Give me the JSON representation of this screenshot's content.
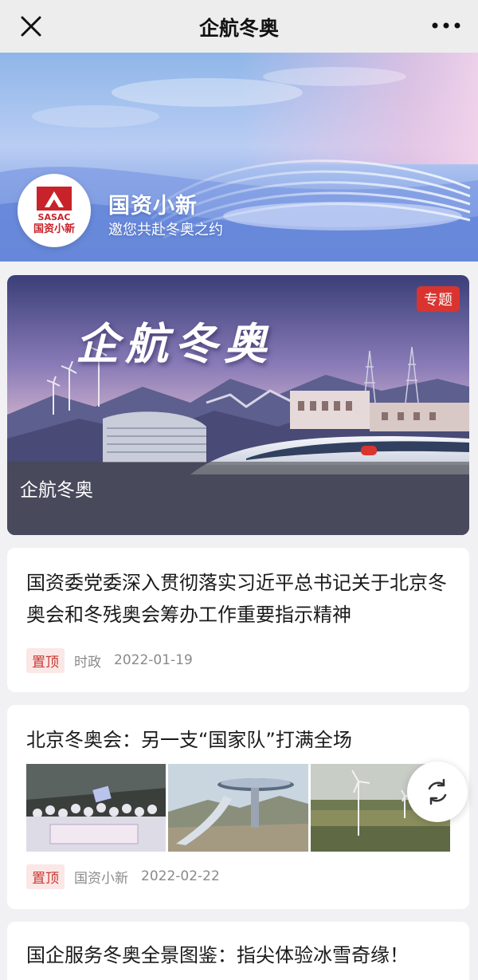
{
  "navbar": {
    "title": "企航冬奥",
    "close_icon": "close-icon",
    "more_icon": "more-icon"
  },
  "banner": {
    "logo_text": "国资小新",
    "logo_brand": "SASAC",
    "account_name": "国资小新",
    "slogan": "邀您共赴冬奥之约"
  },
  "feature": {
    "badge": "专题",
    "art_title": "企航冬奥",
    "caption": "企航冬奥"
  },
  "articles": [
    {
      "title": "国资委党委深入贯彻落实习近平总书记关于北京冬奥会和冬残奥会筹办工作重要指示精神",
      "tag": "置顶",
      "source": "时政",
      "date": "2022-01-19"
    },
    {
      "title": "北京冬奥会：另一支“国家队”打满全场",
      "tag": "置顶",
      "source": "国资小新",
      "date": "2022-02-22",
      "thumbnails": [
        "group-photo",
        "ski-jump-venue",
        "wind-turbines"
      ]
    },
    {
      "title": "国企服务冬奥全景图鉴：指尖体验冰雪奇缘！"
    }
  ],
  "floating": {
    "refresh_icon": "refresh-icon"
  },
  "colors": {
    "accent_red": "#d9342f",
    "tag_bg": "#fbe7e6",
    "tag_text": "#c43a33",
    "meta_gray": "#8a8a8a"
  }
}
